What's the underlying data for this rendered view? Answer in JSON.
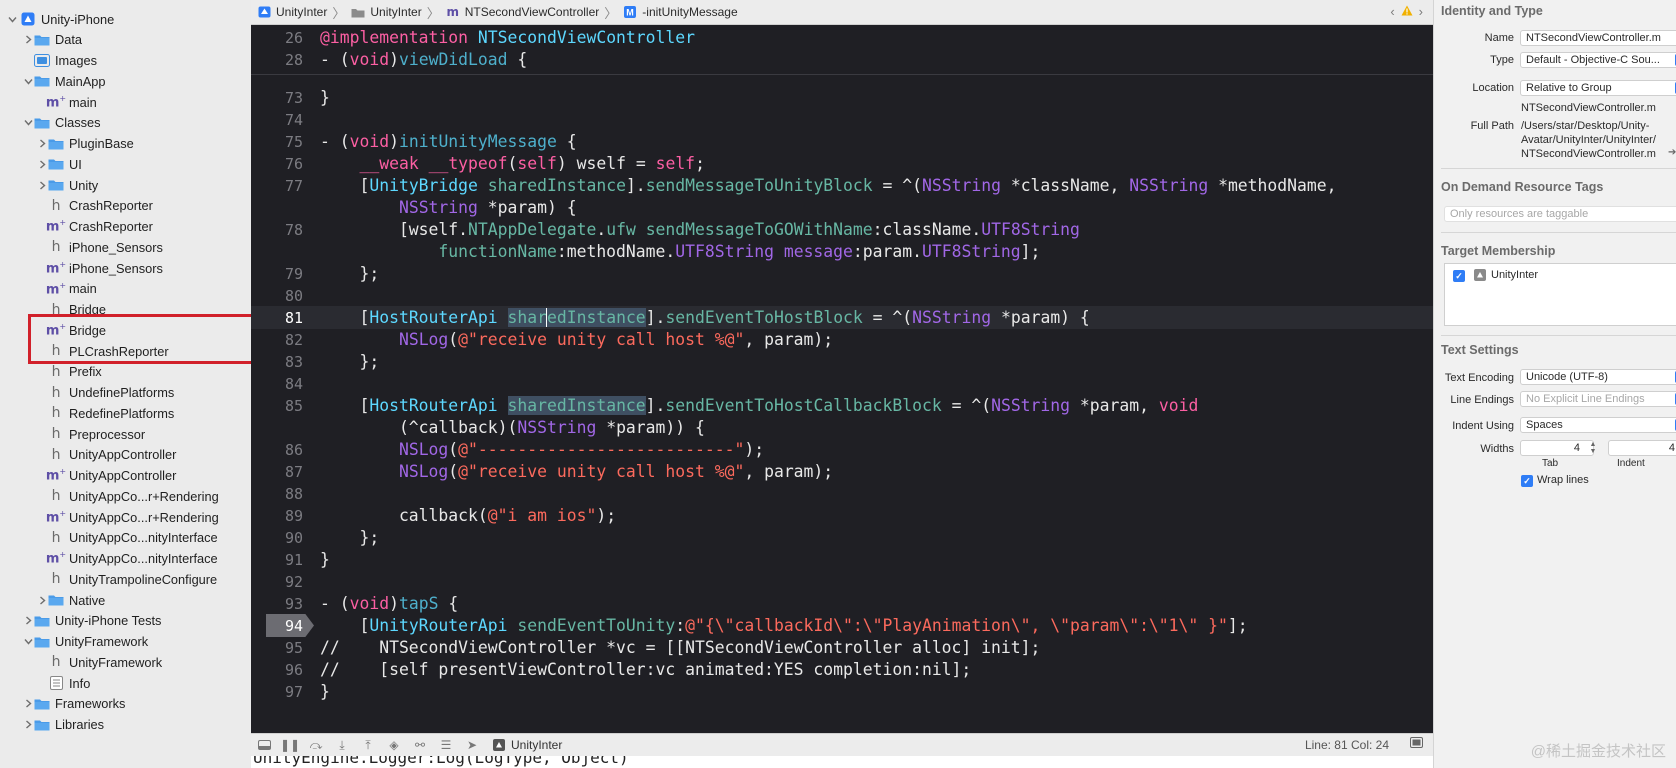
{
  "navigator": {
    "items": [
      {
        "label": "Unity-iPhone",
        "icon": "project-icon",
        "disclosure": "open"
      },
      {
        "label": "Data",
        "icon": "folder-icon",
        "disclosure": "closed"
      },
      {
        "label": "Images",
        "icon": "asset-catalog-icon",
        "disclosure": "none"
      },
      {
        "label": "MainApp",
        "icon": "folder-icon",
        "disclosure": "open"
      },
      {
        "label": "main",
        "icon": "objc-m-file-icon",
        "disclosure": "none"
      },
      {
        "label": "Classes",
        "icon": "folder-icon",
        "disclosure": "open"
      },
      {
        "label": "PluginBase",
        "icon": "folder-icon",
        "disclosure": "closed"
      },
      {
        "label": "UI",
        "icon": "folder-icon",
        "disclosure": "closed"
      },
      {
        "label": "Unity",
        "icon": "folder-icon",
        "disclosure": "closed"
      },
      {
        "label": "CrashReporter",
        "icon": "header-h-file-icon",
        "disclosure": "none"
      },
      {
        "label": "CrashReporter",
        "icon": "objc-m-file-icon",
        "disclosure": "none"
      },
      {
        "label": "iPhone_Sensors",
        "icon": "header-h-file-icon",
        "disclosure": "none"
      },
      {
        "label": "iPhone_Sensors",
        "icon": "objc-m-file-icon",
        "disclosure": "none"
      },
      {
        "label": "main",
        "icon": "objc-m-file-icon",
        "disclosure": "none"
      },
      {
        "label": "Bridge",
        "icon": "header-h-file-icon",
        "disclosure": "none"
      },
      {
        "label": "Bridge",
        "icon": "objc-m-file-icon",
        "disclosure": "none"
      },
      {
        "label": "PLCrashReporter",
        "icon": "header-h-file-icon",
        "disclosure": "none"
      },
      {
        "label": "Prefix",
        "icon": "header-h-file-icon",
        "disclosure": "none"
      },
      {
        "label": "UndefinePlatforms",
        "icon": "header-h-file-icon",
        "disclosure": "none"
      },
      {
        "label": "RedefinePlatforms",
        "icon": "header-h-file-icon",
        "disclosure": "none"
      },
      {
        "label": "Preprocessor",
        "icon": "header-h-file-icon",
        "disclosure": "none"
      },
      {
        "label": "UnityAppController",
        "icon": "header-h-file-icon",
        "disclosure": "none"
      },
      {
        "label": "UnityAppController",
        "icon": "objc-m-file-icon",
        "disclosure": "none"
      },
      {
        "label": "UnityAppCo...r+Rendering",
        "icon": "header-h-file-icon",
        "disclosure": "none"
      },
      {
        "label": "UnityAppCo...r+Rendering",
        "icon": "objc-m-file-icon",
        "disclosure": "none"
      },
      {
        "label": "UnityAppCo...nityInterface",
        "icon": "header-h-file-icon",
        "disclosure": "none"
      },
      {
        "label": "UnityAppCo...nityInterface",
        "icon": "objc-m-file-icon",
        "disclosure": "none"
      },
      {
        "label": "UnityTrampolineConfigure",
        "icon": "header-h-file-icon",
        "disclosure": "none"
      },
      {
        "label": "Native",
        "icon": "folder-icon",
        "disclosure": "closed"
      },
      {
        "label": "Unity-iPhone Tests",
        "icon": "folder-icon",
        "disclosure": "closed"
      },
      {
        "label": "UnityFramework",
        "icon": "folder-icon",
        "disclosure": "open"
      },
      {
        "label": "UnityFramework",
        "icon": "header-h-file-icon",
        "disclosure": "none"
      },
      {
        "label": "Info",
        "icon": "plist-icon",
        "disclosure": "none"
      },
      {
        "label": "Frameworks",
        "icon": "folder-icon",
        "disclosure": "closed"
      },
      {
        "label": "Libraries",
        "icon": "folder-icon",
        "disclosure": "closed"
      }
    ]
  },
  "jumpbar": {
    "crumbs": [
      "UnityInter",
      "UnityInter",
      "NTSecondViewController",
      "-initUnityMessage"
    ]
  },
  "code": {
    "line_numbers": [
      "26",
      "28",
      "73",
      "74",
      "75",
      "76",
      "77",
      "",
      "78",
      "",
      "79",
      "80",
      "81",
      "82",
      "83",
      "84",
      "85",
      "",
      "86",
      "87",
      "88",
      "89",
      "90",
      "91",
      "92",
      "93",
      "94",
      "95",
      "96",
      "97"
    ],
    "current_line": "81",
    "breakpoint_line": "94"
  },
  "debugbar": {
    "scheme": "UnityInter",
    "position": "Line: 81  Col: 24"
  },
  "console_peek": "UnityEngine.Logger:Log(LogType, Object)",
  "inspector": {
    "identity": {
      "title": "Identity and Type",
      "name_label": "Name",
      "name_value": "NTSecondViewController.m",
      "type_label": "Type",
      "type_value": "Default - Objective-C Sou...",
      "location_label": "Location",
      "location_value": "Relative to Group",
      "location_file": "NTSecondViewController.m",
      "fullpath_label": "Full Path",
      "fullpath_l1": "/Users/star/Desktop/Unity-",
      "fullpath_l2": "Avatar/UnityInter/UnityInter/",
      "fullpath_l3": "NTSecondViewController.m"
    },
    "odr": {
      "title": "On Demand Resource Tags",
      "placeholder": "Only resources are taggable"
    },
    "membership": {
      "title": "Target Membership",
      "target": "UnityInter"
    },
    "text_settings": {
      "title": "Text Settings",
      "encoding_label": "Text Encoding",
      "encoding_value": "Unicode (UTF-8)",
      "endings_label": "Line Endings",
      "endings_value": "No Explicit Line Endings",
      "indent_label": "Indent Using",
      "indent_value": "Spaces",
      "widths_label": "Widths",
      "tab_value": "4",
      "indent_width_value": "4",
      "tab_caption": "Tab",
      "indent_caption": "Indent",
      "wrap_label": "Wrap lines"
    }
  },
  "watermark": "@稀土掘金技术社区",
  "colors": {
    "editor_bg": "#1f1f24",
    "keyword": "#fc5fa3",
    "class": "#5dd8ff",
    "string": "#fc6a5d",
    "highlight_box": "#d1202a",
    "accent": "#2f7df6"
  }
}
